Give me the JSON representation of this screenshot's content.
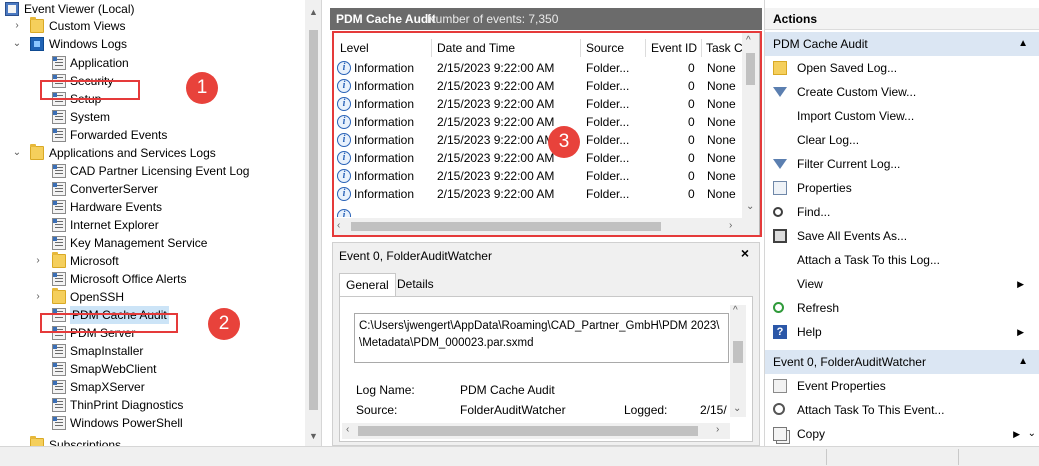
{
  "tree": {
    "root": "Event Viewer (Local)",
    "custom_views": "Custom Views",
    "windows_logs": "Windows Logs",
    "windows_logs_items": [
      "Application",
      "Security",
      "Setup",
      "System",
      "Forwarded Events"
    ],
    "apps_services": "Applications and Services Logs",
    "apps_services_items": [
      "CAD Partner Licensing Event Log",
      "ConverterServer",
      "Hardware Events",
      "Internet Explorer",
      "Key Management Service",
      "Microsoft",
      "Microsoft Office Alerts",
      "OpenSSH",
      "PDM Cache Audit",
      "PDM Server",
      "SmapInstaller",
      "SmapWebClient",
      "SmapXServer",
      "ThinPrint Diagnostics",
      "Windows PowerShell",
      "Subscriptions"
    ]
  },
  "callouts": [
    "1",
    "2",
    "3"
  ],
  "center": {
    "log_name": "PDM Cache Audit",
    "event_count": "Number of events: 7,350",
    "columns": [
      "Level",
      "Date and Time",
      "Source",
      "Event ID",
      "Task C"
    ],
    "rows": [
      {
        "level": "Information",
        "date": "2/15/2023 9:22:00 AM",
        "source": "Folder...",
        "id": "0",
        "task": "None"
      },
      {
        "level": "Information",
        "date": "2/15/2023 9:22:00 AM",
        "source": "Folder...",
        "id": "0",
        "task": "None"
      },
      {
        "level": "Information",
        "date": "2/15/2023 9:22:00 AM",
        "source": "Folder...",
        "id": "0",
        "task": "None"
      },
      {
        "level": "Information",
        "date": "2/15/2023 9:22:00 AM",
        "source": "Folder...",
        "id": "0",
        "task": "None"
      },
      {
        "level": "Information",
        "date": "2/15/2023 9:22:00 AM",
        "source": "Folder...",
        "id": "0",
        "task": "None"
      },
      {
        "level": "Information",
        "date": "2/15/2023 9:22:00 AM",
        "source": "Folder...",
        "id": "0",
        "task": "None"
      },
      {
        "level": "Information",
        "date": "2/15/2023 9:22:00 AM",
        "source": "Folder...",
        "id": "0",
        "task": "None"
      },
      {
        "level": "Information",
        "date": "2/15/2023 9:22:00 AM",
        "source": "Folder...",
        "id": "0",
        "task": "None"
      }
    ],
    "detail": {
      "title": "Event 0, FolderAuditWatcher",
      "close": "×",
      "tabs": [
        "General",
        "Details"
      ],
      "description_line1": "C:\\Users\\jwengert\\AppData\\Roaming\\CAD_Partner_GmbH\\PDM 2023\\",
      "description_line2": "\\Metadata\\PDM_000023.par.sxmd",
      "log_name_label": "Log Name:",
      "log_name_value": "PDM Cache Audit",
      "source_label": "Source:",
      "source_value": "FolderAuditWatcher",
      "logged_label": "Logged:",
      "logged_value": "2/15/"
    }
  },
  "actions": {
    "title": "Actions",
    "section1": "PDM Cache Audit",
    "items1": [
      "Open Saved Log...",
      "Create Custom View...",
      "Import Custom View...",
      "Clear Log...",
      "Filter Current Log...",
      "Properties",
      "Find...",
      "Save All Events As...",
      "Attach a Task To this Log...",
      "View",
      "Refresh",
      "Help"
    ],
    "section2": "Event 0, FolderAuditWatcher",
    "items2": [
      "Event Properties",
      "Attach Task To This Event...",
      "Copy"
    ]
  },
  "colors": {
    "highlight_red": "#e53a3a",
    "header_gray": "#6b6b6b",
    "section_blue": "#dbe6f3"
  }
}
